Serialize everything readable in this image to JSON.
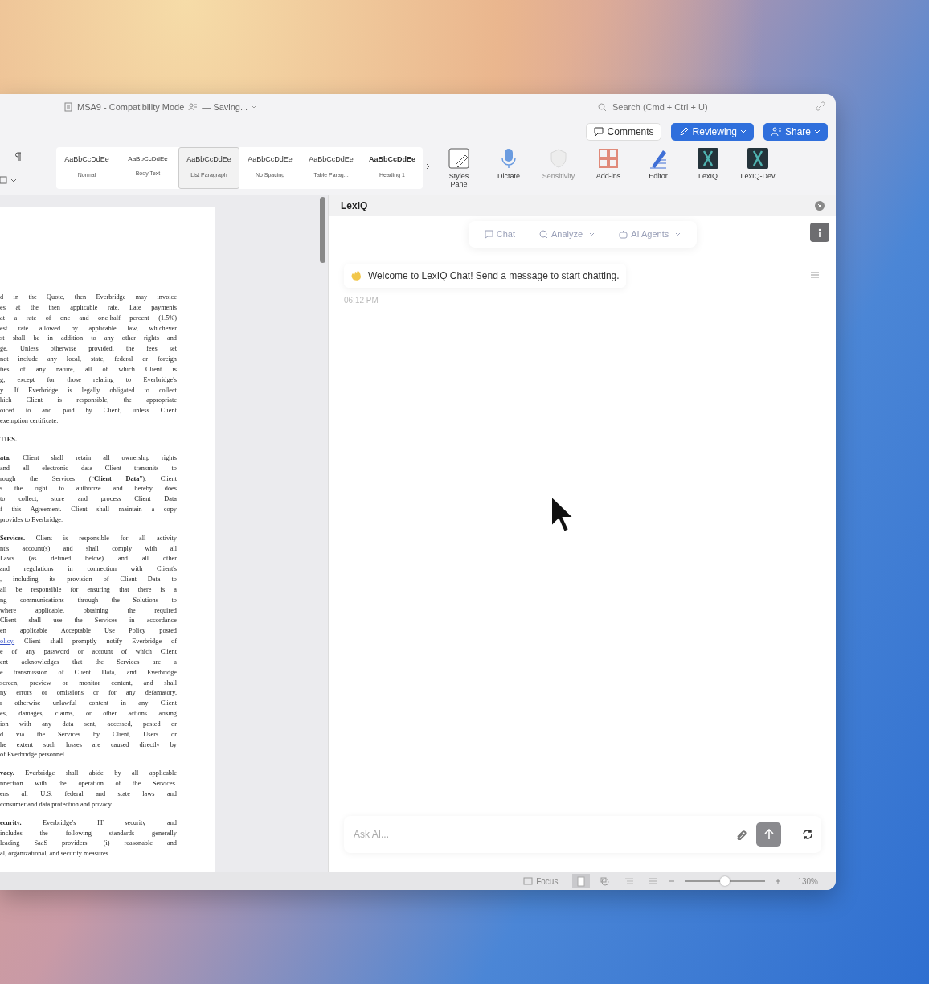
{
  "window": {
    "title": "MSA9 - Compatibility Mode",
    "save_status": "— Saving...",
    "search": {
      "placeholder": "Search (Cmd + Ctrl + U)"
    }
  },
  "actions": [
    {
      "kind": "comments",
      "label": "Comments"
    },
    {
      "kind": "reviewing",
      "label": "Reviewing"
    },
    {
      "kind": "share",
      "label": "Share"
    }
  ],
  "ribbon": {
    "styles": [
      {
        "sample": "AaBbCcDdEe",
        "label": "Normal",
        "selected": false
      },
      {
        "sample": "AaBbCcDdEe",
        "label": "Body Text",
        "selected": false
      },
      {
        "sample": "AaBbCcDdEe",
        "label": "List Paragraph",
        "selected": true
      },
      {
        "sample": "AaBbCcDdEe",
        "label": "No Spacing",
        "selected": false
      },
      {
        "sample": "AaBbCcDdEe",
        "label": "Table Parag...",
        "selected": false
      },
      {
        "sample": "AaBbCcDdEe",
        "label": "Heading 1",
        "selected": false
      }
    ],
    "tools": [
      {
        "kind": "styles-pane",
        "label": "Styles Pane",
        "disabled": false
      },
      {
        "kind": "dictate",
        "label": "Dictate",
        "disabled": false
      },
      {
        "kind": "sensitivity",
        "label": "Sensitivity",
        "disabled": true
      },
      {
        "kind": "add-ins",
        "label": "Add-ins",
        "disabled": false
      },
      {
        "kind": "editor",
        "label": "Editor",
        "disabled": false
      },
      {
        "kind": "app",
        "label": "LexIQ",
        "disabled": false
      },
      {
        "kind": "app",
        "label": "LexIQ-Dev",
        "disabled": false
      }
    ]
  },
  "document": {
    "paragraphs": [
      {
        "kind": "body",
        "lines": [
          "d in the Quote, then Everbridge may invoice",
          "es at the then applicable rate. Late payments",
          "at a rate of one and one-half percent (1.5%)",
          "est rate allowed by applicable law, whichever",
          "st shall be in addition to any other rights and",
          "ge. Unless otherwise provided, the fees set",
          "not include any local, state, federal or foreign",
          "ties of any nature, all of which Client is",
          "g, except for those relating to Everbridge's",
          "y. If Everbridge is legally obligated to collect",
          "hich Client is responsible, the appropriate",
          "oiced to and paid by Client, unless Client",
          "exemption certificate."
        ]
      },
      {
        "kind": "heading",
        "lines": [
          "TIES."
        ]
      },
      {
        "kind": "body",
        "lines": [
          "**ata.** Client shall retain all ownership rights",
          "and all electronic data Client transmits to",
          "rough the Services (“**Client Data**”). Client",
          "s the right to authorize and hereby does",
          "to collect, store and process Client Data",
          "f this Agreement. Client shall maintain a copy",
          "provides to Everbridge."
        ]
      },
      {
        "kind": "body",
        "lines": [
          "**Services.** Client is responsible for all activity",
          "nt's account(s) and shall comply with all",
          "Laws (as defined below) and all other",
          "and regulations in connection with Client's",
          ", including its provision of Client Data to",
          "all be responsible for ensuring that there is a",
          "ng communications through the Solutions to",
          "where applicable, obtaining the required",
          "Client shall use the Services in accordance",
          "en applicable Acceptable Use Policy posted",
          {
            "link": "olicy.",
            "text": " Client shall promptly notify Everbridge of"
          },
          "e of any password or account of which Client",
          "ent acknowledges that the Services are a",
          "e transmission of Client Data, and Everbridge",
          "screen, preview or monitor content, and shall",
          "ny errors or omissions or for any defamatory,",
          "r otherwise unlawful content in any Client",
          "es, damages, claims, or other actions arising",
          "ion with any data sent, accessed, posted or",
          "d via the Services by Client, Users or",
          "he extent such losses are caused directly by",
          "of Everbridge personnel."
        ]
      },
      {
        "kind": "body",
        "lines": [
          "**vacy.** Everbridge shall abide by all applicable",
          "nnection with the operation of the Services.",
          "ens all U.S. federal and state laws and",
          "consumer and data protection and privacy"
        ]
      },
      {
        "kind": "body",
        "lines": [
          "**ecurity.** Everbridge's IT security and",
          "includes the following standards generally",
          "leading SaaS providers: (i) reasonable and",
          "al, organizational, and security measures"
        ]
      }
    ]
  },
  "panel": {
    "title": "LexIQ",
    "tabs": [
      {
        "kind": "chat",
        "label": "Chat",
        "dropdown": false
      },
      {
        "kind": "analyze",
        "label": "Analyze",
        "dropdown": true
      },
      {
        "kind": "agents",
        "label": "AI Agents",
        "dropdown": true
      }
    ],
    "messages": [
      {
        "text": "Welcome to LexIQ Chat! Send a message to start chatting.",
        "time": "06:12 PM"
      }
    ],
    "input": {
      "placeholder": "Ask AI..."
    }
  },
  "status_bar": {
    "focus": "Focus",
    "views": [
      {
        "kind": "print",
        "selected": true
      },
      {
        "kind": "web",
        "selected": false
      },
      {
        "kind": "outline",
        "selected": false
      },
      {
        "kind": "draft",
        "selected": false
      }
    ],
    "zoom": {
      "level": 0.5,
      "reading": "130%"
    }
  }
}
